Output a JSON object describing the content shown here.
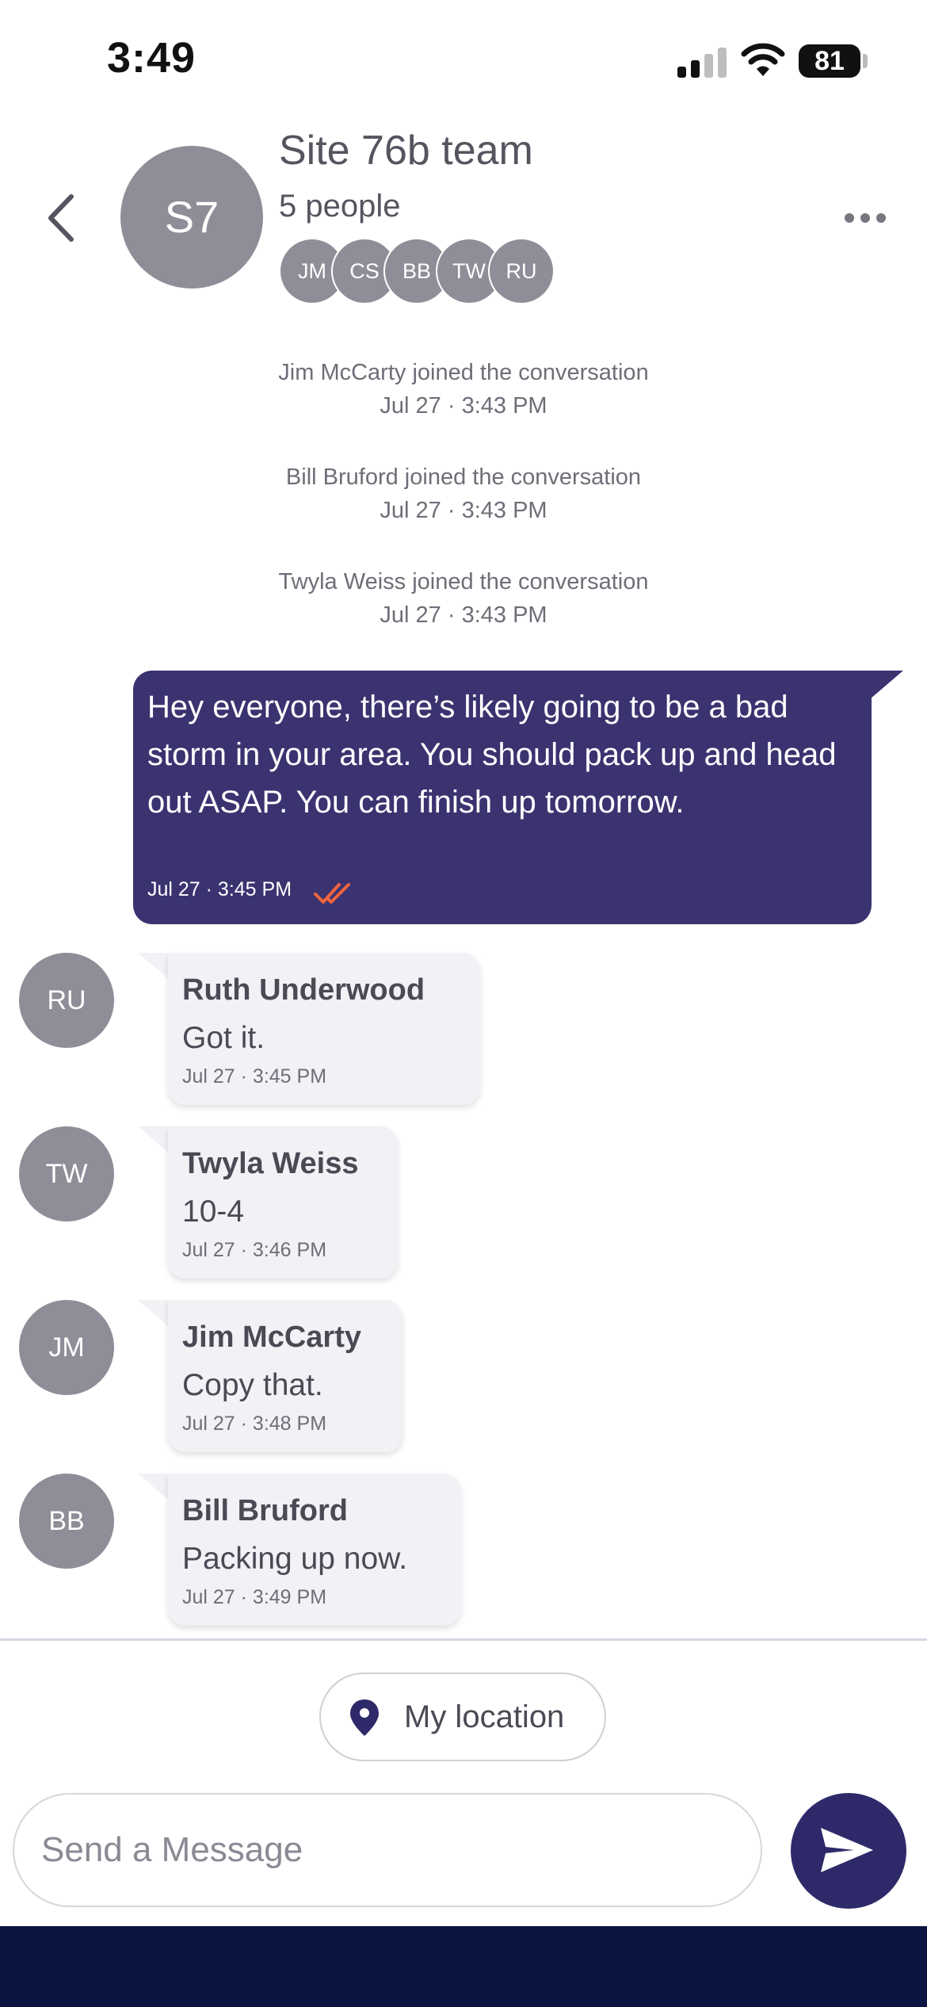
{
  "status_bar": {
    "time": "3:49",
    "battery": "81",
    "icons": [
      "signal-icon",
      "wifi-icon",
      "battery-icon"
    ]
  },
  "header": {
    "avatar_initials": "S7",
    "title": "Site 76b team",
    "subtitle": "5 people",
    "members": [
      "JM",
      "CS",
      "BB",
      "TW",
      "RU"
    ],
    "icons": [
      "back-chevron-icon",
      "more-dots-icon"
    ]
  },
  "events": [
    {
      "text": "Jim McCarty joined the conversation",
      "time": "Jul 27 · 3:43 PM"
    },
    {
      "text": "Bill Bruford joined the conversation",
      "time": "Jul 27 · 3:43 PM"
    },
    {
      "text": "Twyla Weiss joined the conversation",
      "time": "Jul 27 · 3:43 PM"
    }
  ],
  "outgoing": {
    "text": "Hey everyone, there’s likely going to be a bad storm in your area. You should pack up and head out ASAP. You can finish up tomorrow.",
    "time": "Jul 27 · 3:45 PM",
    "status_icon": "double-check-icon",
    "bubble_color": "#3a3370",
    "check_color": "#f0643c"
  },
  "incoming": [
    {
      "initials": "RU",
      "name": "Ruth Underwood",
      "text": "Got it.",
      "time": "Jul 27 · 3:45 PM"
    },
    {
      "initials": "TW",
      "name": "Twyla Weiss",
      "text": "10-4",
      "time": "Jul 27 · 3:46 PM"
    },
    {
      "initials": "JM",
      "name": "Jim McCarty",
      "text": "Copy that.",
      "time": "Jul 27 · 3:48 PM"
    },
    {
      "initials": "BB",
      "name": "Bill Bruford",
      "text": "Packing up now.",
      "time": "Jul 27 · 3:49 PM"
    }
  ],
  "composer": {
    "location_label": "My location",
    "placeholder": "Send a Message",
    "icons": [
      "location-pin-icon",
      "send-icon"
    ],
    "accent": "#2e2a6a"
  }
}
